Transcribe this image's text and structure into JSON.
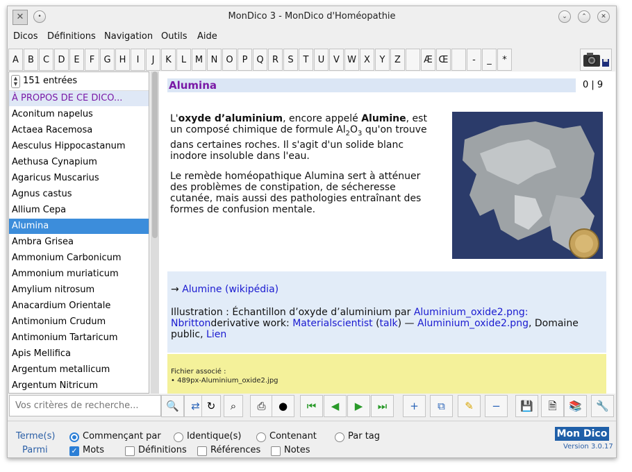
{
  "window": {
    "title": "MonDico 3 - MonDico d'Homéopathie"
  },
  "menu": [
    "Dicos",
    "Définitions",
    "Navigation",
    "Outils",
    "Aide"
  ],
  "letters": [
    "A",
    "B",
    "C",
    "D",
    "E",
    "F",
    "G",
    "H",
    "I",
    "J",
    "K",
    "L",
    "M",
    "N",
    "O",
    "P",
    "Q",
    "R",
    "S",
    "T",
    "U",
    "V",
    "W",
    "X",
    "Y",
    "Z",
    "",
    "Æ",
    "Œ",
    "",
    "-",
    "_",
    "*"
  ],
  "list": {
    "count_label": "151 entrées",
    "about": "À PROPOS DE CE DICO...",
    "items": [
      "Aconitum napelus",
      "Actaea Racemosa",
      "Aesculus Hippocastanum",
      "Aethusa Cynapium",
      "Agaricus Muscarius",
      "Agnus castus",
      "Allium Cepa",
      "Alumina",
      "Ambra Grisea",
      "Ammonium Carbonicum",
      "Ammonium muriaticum",
      "Amylium nitrosum",
      "Anacardium Orientale",
      "Antimonium Crudum",
      "Antimonium Tartaricum",
      "Apis Mellifica",
      "Argentum metallicum",
      "Argentum Nitricum"
    ],
    "selected": "Alumina"
  },
  "entry": {
    "title": "Alumina",
    "pager": "0 | 9",
    "p1_pre": "L'",
    "p1_b1": "oxyde d’aluminium",
    "p1_mid": ", encore appelé ",
    "p1_b2": "Alumine",
    "p1_line1_end": ", est",
    "p1_line2a": "un composé chimique de formule Al",
    "p1_sub1": "2",
    "p1_line2b": "O",
    "p1_sub2": "3",
    "p1_line2c": " qu'on trouve",
    "p1_line3": "dans certaines roches. Il s'agit d'un solide blanc",
    "p1_line4": "inodore insoluble dans l'eau.",
    "p2_line1": "Le remède homéopathique Alumina sert à atténuer",
    "p2_line2": "des problèmes de constipation, de sécheresse",
    "p2_line3": "cutanée, mais aussi des pathologies entraînant des",
    "p2_line4": "formes de confusion mentale.",
    "link_arrow": "→ ",
    "link_wiki": "Alumine (wikipédia)",
    "illus_pre": "Illustration : Échantillon d’oxyde d’aluminium par ",
    "illus_link1": "Aluminium_oxide2.png:",
    "illus_link2": "Nbritton",
    "illus_mid1": "derivative work: ",
    "illus_link3": "Materialscientist",
    "illus_paren_open": " (",
    "illus_link4": "talk",
    "illus_paren_close": ") — ",
    "illus_link5": "Aluminium_oxide2.png",
    "illus_mid2": ", Domaine",
    "illus_line3a": "public, ",
    "illus_link6": "Lien",
    "file_label": "Fichier associé :",
    "file_name": "• 489px-Aluminium_oxide2.jpg"
  },
  "search": {
    "placeholder": "Vos critères de recherche..."
  },
  "options": {
    "terms_label": "Terme(s)",
    "among_label": "Parmi",
    "radios": [
      "Commençant par",
      "Identique(s)",
      "Contenant",
      "Par tag"
    ],
    "radio_selected": "Commençant par",
    "checks": [
      "Mots",
      "Définitions",
      "Références",
      "Notes"
    ],
    "checks_on": [
      "Mots"
    ]
  },
  "brand": {
    "logo": "Mon Dico",
    "version": "Version 3.0.17"
  },
  "colors": {
    "selection": "#3c8ddb",
    "title_purple": "#7a1aa6",
    "link": "#1a1ad0",
    "linkbox": "#e2ecf8",
    "filebox": "#f4f19a"
  }
}
